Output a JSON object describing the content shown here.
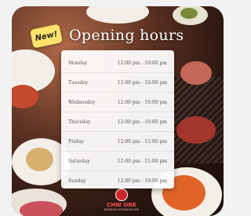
{
  "badge": {
    "label": "New!"
  },
  "title": "Opening hours",
  "hours": [
    {
      "day": "Monday",
      "time": "12:00 pm - 10:00 pm"
    },
    {
      "day": "Tuesday",
      "time": "12:00 pm - 10:00 pm"
    },
    {
      "day": "Wednesday",
      "time": "12:00 pm - 10:00 pm"
    },
    {
      "day": "Thursday",
      "time": "12:00 pm - 10:00 pm"
    },
    {
      "day": "Friday",
      "time": "12:00 pm - 11:00 pm"
    },
    {
      "day": "Saturday",
      "time": "12:00 pm - 11:00 pm"
    },
    {
      "day": "Sunday",
      "time": "12:00 pm - 10:00 pm"
    }
  ],
  "logo": {
    "name": "CHW ONE",
    "sub": "KOREAN STEAKHOUSE"
  }
}
